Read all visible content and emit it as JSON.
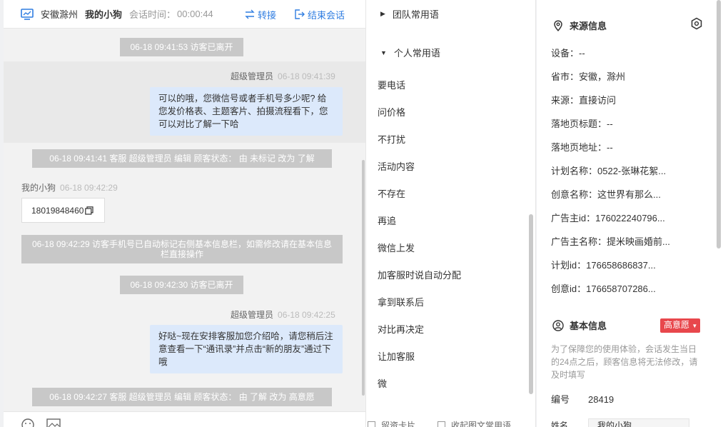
{
  "header": {
    "location": "安徽滁州",
    "visitor_name": "我的小狗",
    "session_time_label": "会话时间：",
    "session_time": "00:00:44",
    "transfer_label": "转接",
    "end_label": "结束会话"
  },
  "messages": {
    "sys1": "06-18 09:41:53 访客已离开",
    "agent1_name": "超级管理员",
    "agent1_time": "06-18 09:41:39",
    "agent1_text": "可以的哦，您微信号或者手机号多少呢? 给您发价格表、主题客片、拍摄流程看下，您可以对比了解一下哈",
    "sys2": "06-18 09:41:41 客服 超级管理员 编辑 顾客状态：  由 未标记 改为 了解",
    "visitor1_name": "我的小狗",
    "visitor1_time": "06-18 09:42:29",
    "visitor1_phone": "18019848460",
    "sys3": "06-18 09:42:29 访客手机号已自动标记右侧基本信息栏，如需修改请在基本信息栏直接操作",
    "sys4": "06-18 09:42:30 访客已离开",
    "agent2_name": "超级管理员",
    "agent2_time": "06-18 09:42:25",
    "agent2_text": "好哒~现在安排客服加您介绍哈，请您稍后注意查看一下“通讯录”并点击“新的朋友”通过下哦",
    "sys5": "06-18 09:42:27 客服 超级管理员 编辑 顾客状态：  由 了解 改为 高意愿"
  },
  "phrases": {
    "team_group": "团队常用语",
    "personal_group": "个人常用语",
    "items": [
      "要电话",
      "问价格",
      "不打扰",
      "活动内容",
      "不存在",
      "再追",
      "微信上发",
      "加客服时说自动分配",
      "拿到联系后",
      "对比再决定",
      "让加客服",
      "微"
    ],
    "footer_left": "留资卡片",
    "footer_right": "收起图文常用语"
  },
  "info": {
    "source_title": "来源信息",
    "rows": [
      {
        "label": "设备：",
        "value": "--"
      },
      {
        "label": "省市：",
        "value": "安徽，滁州"
      },
      {
        "label": "来源：",
        "value": "直接访问"
      },
      {
        "label": "落地页标题：",
        "value": "--"
      },
      {
        "label": "落地页地址：",
        "value": "--"
      },
      {
        "label": "计划名称：",
        "value": "0522-张琳花絮..."
      },
      {
        "label": "创意名称：",
        "value": "这世界有那么..."
      },
      {
        "label": "广告主id：",
        "value": "176022240796..."
      },
      {
        "label": "广告主名称：",
        "value": "提米映画婚前..."
      },
      {
        "label": "计划id：",
        "value": "176658686837..."
      },
      {
        "label": "创意id：",
        "value": "176658707286..."
      }
    ],
    "basic_title": "基本信息",
    "badge": "高意愿",
    "note": "为了保障您的使用体验，会话发生当日的24点之后，顾客信息将无法修改，请及时填写",
    "number_label": "编号",
    "number_value": "28419",
    "name_label": "姓名",
    "name_value": "我的小狗"
  }
}
